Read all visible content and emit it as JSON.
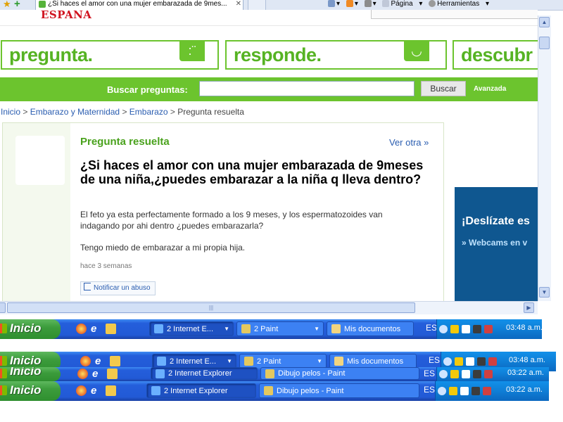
{
  "browser": {
    "tab_title": "¿Si haces el amor con una mujer embarazada de 9mes...",
    "tools": {
      "page_label": "Página",
      "tools_label": "Herramientas"
    }
  },
  "site": {
    "logo": "ESPAÑA",
    "taglines": [
      "pregunta.",
      "responde.",
      "descubr"
    ],
    "search_label": "Buscar preguntas:",
    "search_value": "",
    "search_button": "Buscar",
    "advanced_link": "Avanzada"
  },
  "breadcrumb": {
    "items": [
      "Inicio",
      "Embarazo y Maternidad",
      "Embarazo"
    ],
    "current": "Pregunta resuelta",
    "separator": " > "
  },
  "question": {
    "status": "Pregunta resuelta",
    "see_other": "Ver otra »",
    "title": "¿Si haces el amor con una mujer embarazada de 9meses de una niña,¿puedes embarazar a la niña q lleva dentro?",
    "body1": "El feto ya esta perfectamente formado a los 9 meses, y los espermatozoides van indagando por ahi dentro ¿puedes embarazarla?",
    "body2": "Tengo miedo de embarazar a mi propia hija.",
    "time_ago": "hace 3 semanas",
    "report_abuse": "Notificar un abuso"
  },
  "ad": {
    "line1": "¡Deslízate es",
    "line2": "» Webcams en v"
  },
  "taskbars": [
    {
      "start": "Inicio",
      "tasks": [
        "2 Internet E...",
        "2 Paint",
        "Mis documentos"
      ],
      "lang": "ES",
      "clock": "03:48 a.m."
    },
    {
      "start": "Inicio",
      "tasks": [
        "2 Internet E...",
        "2 Paint",
        "Mis documentos"
      ],
      "lang": "ES",
      "clock": "03:48 a.m."
    },
    {
      "start": "Inicio",
      "tasks": [
        "2 Internet Explorer",
        "Dibujo pelos - Paint"
      ],
      "lang": "ES",
      "clock": "03:22 a.m."
    },
    {
      "start": "Inicio",
      "tasks": [
        "2 Internet Explorer",
        "Dibujo pelos - Paint"
      ],
      "lang": "ES",
      "clock": "03:22 a.m."
    }
  ],
  "colors": {
    "brand_green": "#6cc42e",
    "link_blue": "#2a5db0",
    "logo_red": "#d0131f",
    "taskbar_blue": "#245edb"
  }
}
